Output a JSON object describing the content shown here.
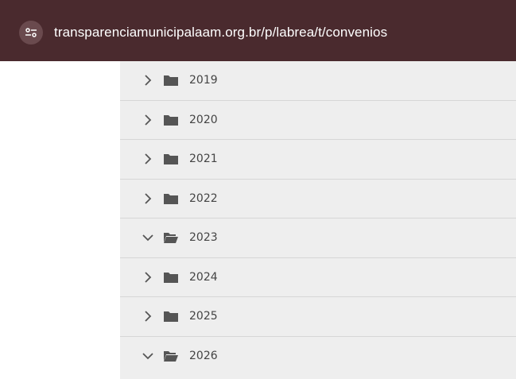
{
  "browser": {
    "url": "transparenciamunicipalaam.org.br/p/labrea/t/convenios"
  },
  "tree": {
    "folders": [
      {
        "label": "2019",
        "state": "collapsed"
      },
      {
        "label": "2020",
        "state": "collapsed"
      },
      {
        "label": "2021",
        "state": "collapsed"
      },
      {
        "label": "2022",
        "state": "collapsed"
      },
      {
        "label": "2023",
        "state": "expanded"
      },
      {
        "label": "2024",
        "state": "collapsed"
      },
      {
        "label": "2025",
        "state": "collapsed"
      },
      {
        "label": "2026",
        "state": "expanded"
      }
    ]
  },
  "colors": {
    "urlbar_bg": "#4a2a2e",
    "tree_bg": "#eeeeee",
    "icon": "#555555"
  },
  "icons": {
    "site_info": "tune-icon",
    "collapsed_chevron": "chevron-right-icon",
    "expanded_chevron": "chevron-down-icon",
    "closed_folder": "folder-icon",
    "open_folder": "folder-open-icon"
  }
}
